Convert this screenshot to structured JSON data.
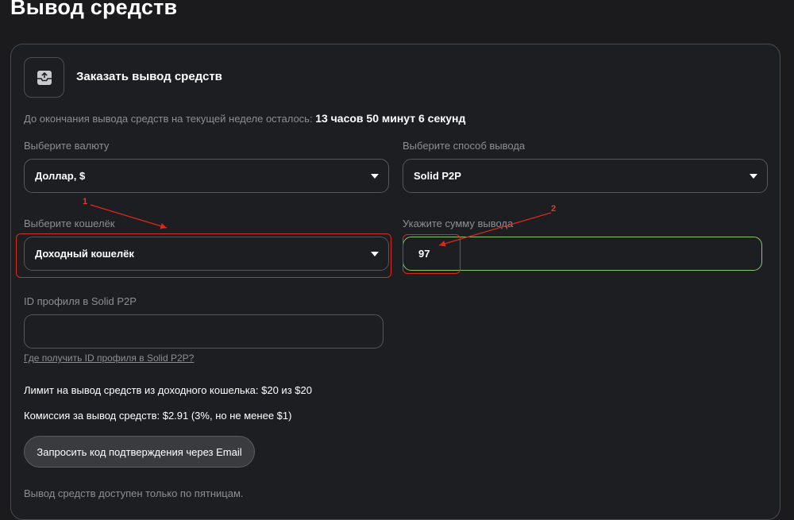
{
  "page": {
    "title": "Вывод средств"
  },
  "card": {
    "icon": "upload-icon",
    "title": "Заказать вывод средств",
    "timer_label": "До окончания вывода средств на текущей неделе осталось:",
    "timer_value": "13 часов 50 минут 6 секунд"
  },
  "currency": {
    "label": "Выберите валюту",
    "selected": "Доллар, $"
  },
  "method": {
    "label": "Выберите способ вывода",
    "selected": "Solid P2P"
  },
  "wallet": {
    "label": "Выберите кошелёк",
    "selected": "Доходный кошелёк"
  },
  "amount": {
    "label": "Укажите сумму вывода",
    "value": "97"
  },
  "profile": {
    "label": "ID профиля в Solid P2P",
    "value": "",
    "help_link": "Где получить ID профиля в Solid P2P?"
  },
  "limits": {
    "limit_text": "Лимит на вывод средств из доходного кошелька: $20 из $20",
    "commission_text": "Комиссия за вывод средств: $2.91 (3%, но не менее $1)"
  },
  "actions": {
    "email_button": "Запросить код подтверждения через Email"
  },
  "footer": {
    "note": "Вывод средств доступен только по пятницам."
  },
  "annotations": {
    "marker_1": "1",
    "marker_2": "2",
    "color": "#d8291c"
  },
  "colors": {
    "background": "#1b1b1e",
    "border": "#55565b",
    "valid_border": "#8cc56a",
    "muted_text": "#8d8e93"
  }
}
